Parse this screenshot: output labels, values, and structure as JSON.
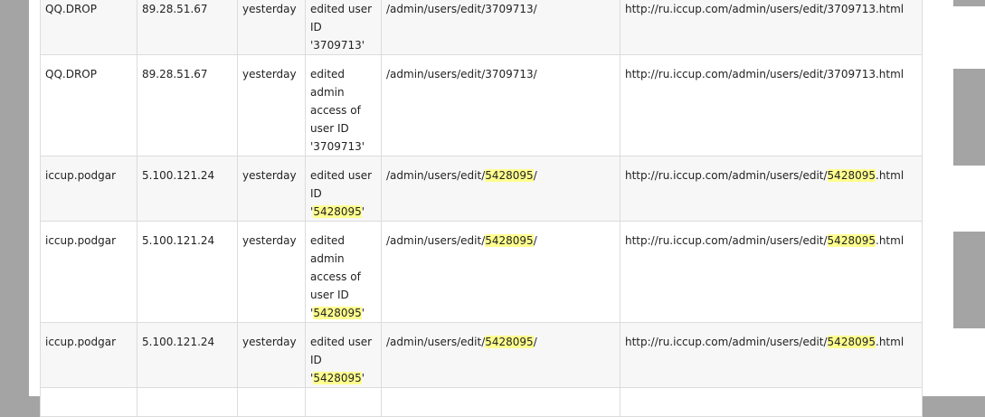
{
  "rows": [
    {
      "user": "QQ.DROP",
      "ip": "89.28.51.67",
      "date": "yesterday",
      "action": [
        "edited user",
        "ID",
        "'3709713'"
      ],
      "path": "/admin/users/edit/3709713/",
      "url": "http://ru.iccup.com/admin/users/edit/3709713.html"
    },
    {
      "user": "QQ.DROP",
      "ip": "89.28.51.67",
      "date": "yesterday",
      "action": [
        "edited",
        "admin",
        "access of",
        "user ID",
        "'3709713'"
      ],
      "path": "/admin/users/edit/3709713/",
      "url": "http://ru.iccup.com/admin/users/edit/3709713.html"
    },
    {
      "user": "iccup.podgar",
      "ip": "5.100.121.24",
      "date": "yesterday",
      "action": [
        "edited user",
        "ID",
        "'5428095'"
      ],
      "path_pre": "/admin/users/edit/",
      "path_hl": "5428095",
      "path_post": "/",
      "url_pre": "http://ru.iccup.com/admin/users/edit/",
      "url_hl": "5428095",
      "url_post": ".html"
    },
    {
      "user": "iccup.podgar",
      "ip": "5.100.121.24",
      "date": "yesterday",
      "action": [
        "edited",
        "admin",
        "access of",
        "user ID",
        "'5428095'"
      ],
      "path_pre": "/admin/users/edit/",
      "path_hl": "5428095",
      "path_post": "/",
      "url_pre": "http://ru.iccup.com/admin/users/edit/",
      "url_hl": "5428095",
      "url_post": ".html"
    },
    {
      "user": "iccup.podgar",
      "ip": "5.100.121.24",
      "date": "yesterday",
      "action": [
        "edited user",
        "ID",
        "'5428095'"
      ],
      "path_pre": "/admin/users/edit/",
      "path_hl": "5428095",
      "path_post": "/",
      "url_pre": "http://ru.iccup.com/admin/users/edit/",
      "url_hl": "5428095",
      "url_post": ".html"
    }
  ],
  "highlight_id": "5428095",
  "colors": {
    "highlight": "#ffff8f",
    "backdrop": "#a4a4a4"
  }
}
